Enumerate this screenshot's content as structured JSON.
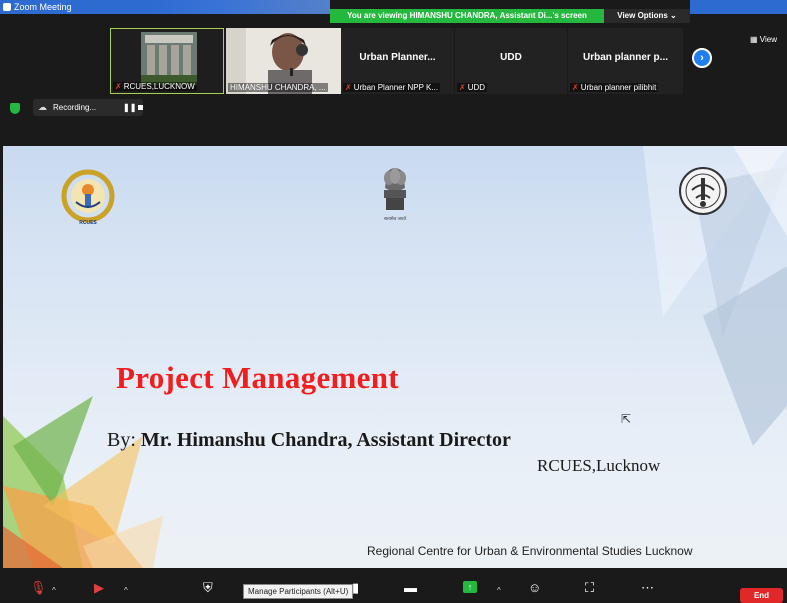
{
  "window": {
    "title": "Zoom Meeting",
    "viewing_banner": "You are viewing HIMANSHU CHANDRA, Assistant Di...'s screen",
    "view_options_label": "View Options ⌄"
  },
  "participants": [
    {
      "name": "RCUES,LUCKNOW",
      "muted": true,
      "has_video": true
    },
    {
      "name": "HIMANSHU CHANDRA, ...",
      "muted": false,
      "has_video": true
    },
    {
      "display": "Urban Planner...",
      "name": "Urban Planner NPP K...",
      "muted": true,
      "has_video": false
    },
    {
      "display": "UDD",
      "name": "UDD",
      "muted": true,
      "has_video": false
    },
    {
      "display": "Urban planner p...",
      "name": "Urban planner pilibhit",
      "muted": true,
      "has_video": false
    }
  ],
  "strip": {
    "view_label": "View"
  },
  "recording": {
    "label": "Recording..."
  },
  "slide": {
    "title": "Project  Management",
    "by_prefix": "By: ",
    "by_name": "Mr. Himanshu Chandra, Assistant Director",
    "org": "RCUES,Lucknow",
    "footer": "Regional Centre for Urban & Environmental Studies Lucknow",
    "left_emblem_text": "RCUES LUCKNOW",
    "center_emblem_text": "सत्यमेव जयते"
  },
  "toolbar": {
    "tooltip": "Manage Participants (Alt+U)",
    "end_label": "End"
  },
  "colors": {
    "accent_blue": "#2d6bd1",
    "banner_green": "#25b83e",
    "title_red": "#f21d1d",
    "end_red": "#e02828"
  }
}
